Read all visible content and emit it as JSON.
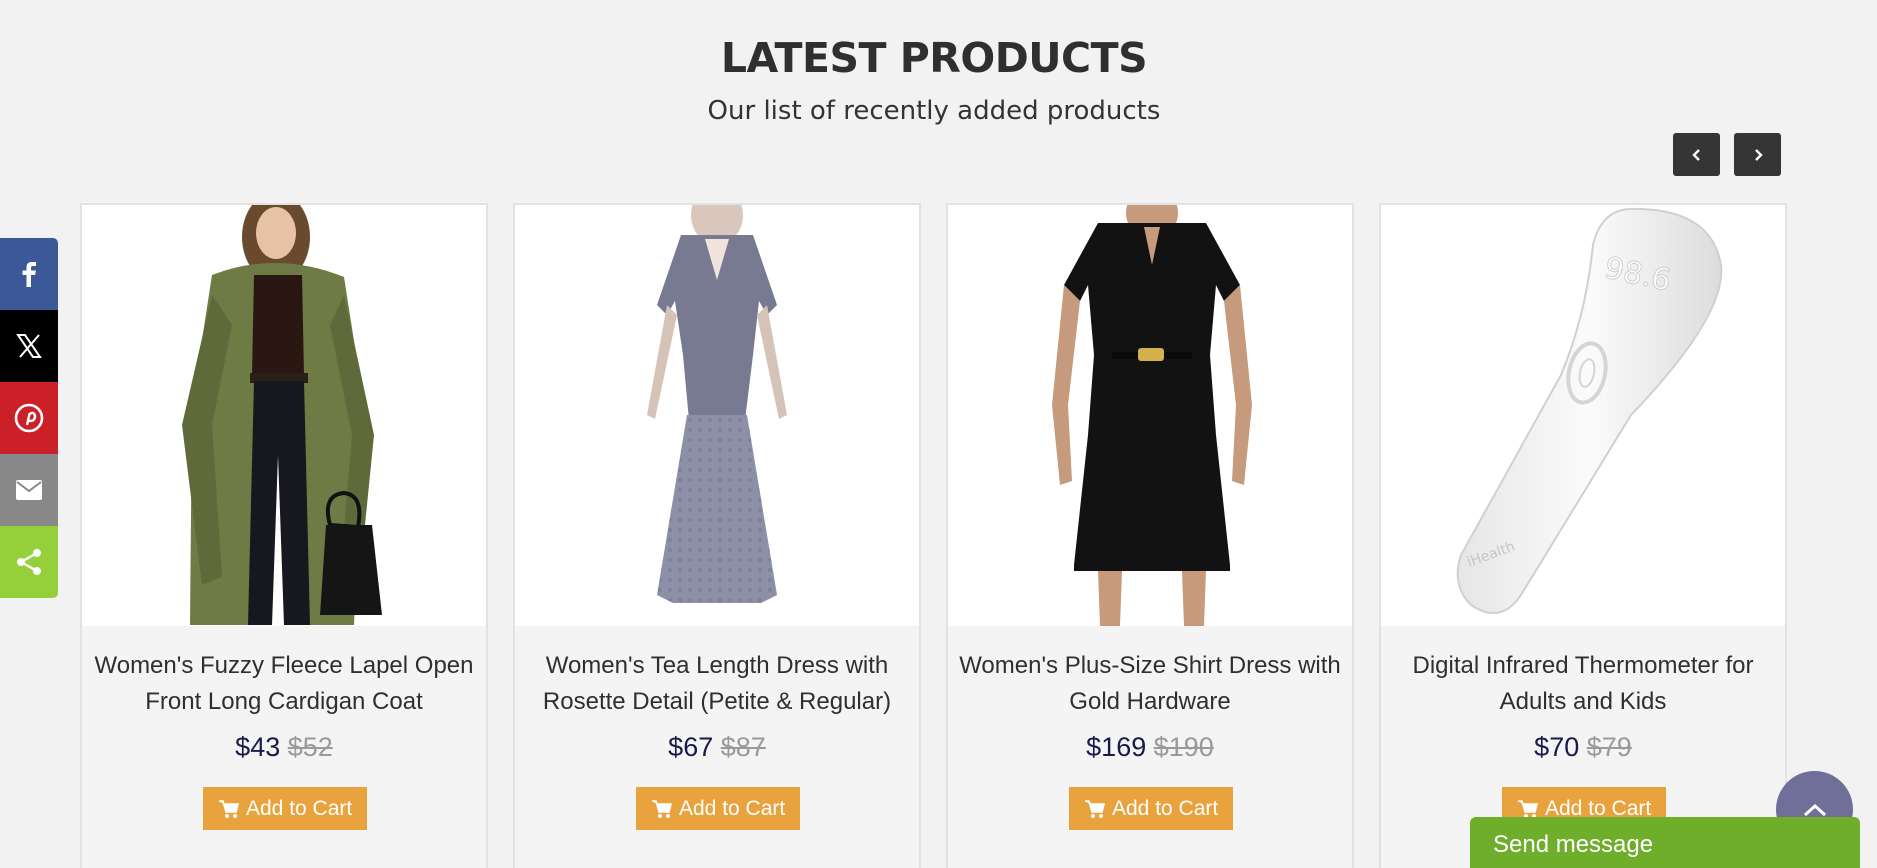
{
  "section": {
    "title": "LATEST PRODUCTS",
    "subtitle": "Our list of recently added products"
  },
  "carousel": {
    "prev_icon": "chevron-left-icon",
    "next_icon": "chevron-right-icon"
  },
  "products": [
    {
      "name": "Women's Fuzzy Fleece Lapel Open Front Long Cardigan Coat",
      "price": "$43",
      "old_price": "$52",
      "cart_label": "Add to Cart"
    },
    {
      "name": "Women's Tea Length Dress with Rosette Detail (Petite & Regular)",
      "price": "$67",
      "old_price": "$87",
      "cart_label": "Add to Cart"
    },
    {
      "name": "Women's Plus-Size Shirt Dress with Gold Hardware",
      "price": "$169",
      "old_price": "$190",
      "cart_label": "Add to Cart"
    },
    {
      "name": "Digital Infrared Thermometer for Adults and Kids",
      "price": "$70",
      "old_price": "$79",
      "cart_label": "Add to Cart",
      "image_text": "98.6",
      "brand_mark": "iHealth"
    }
  ],
  "share": {
    "items": [
      "facebook-icon",
      "x-icon",
      "pinterest-icon",
      "mail-icon",
      "share-icon"
    ],
    "colors": {
      "facebook": "#3b5998",
      "x": "#000000",
      "pinterest": "#cb2027",
      "mail": "#888888",
      "share": "#95d03a"
    }
  },
  "widgets": {
    "send_message": "Send message",
    "scroll_top_icon": "chevron-up-icon"
  },
  "colors": {
    "background": "#f1f2f1",
    "cart_button": "#e9a33e",
    "send_message": "#6fae2a",
    "nav_button": "#353535"
  }
}
